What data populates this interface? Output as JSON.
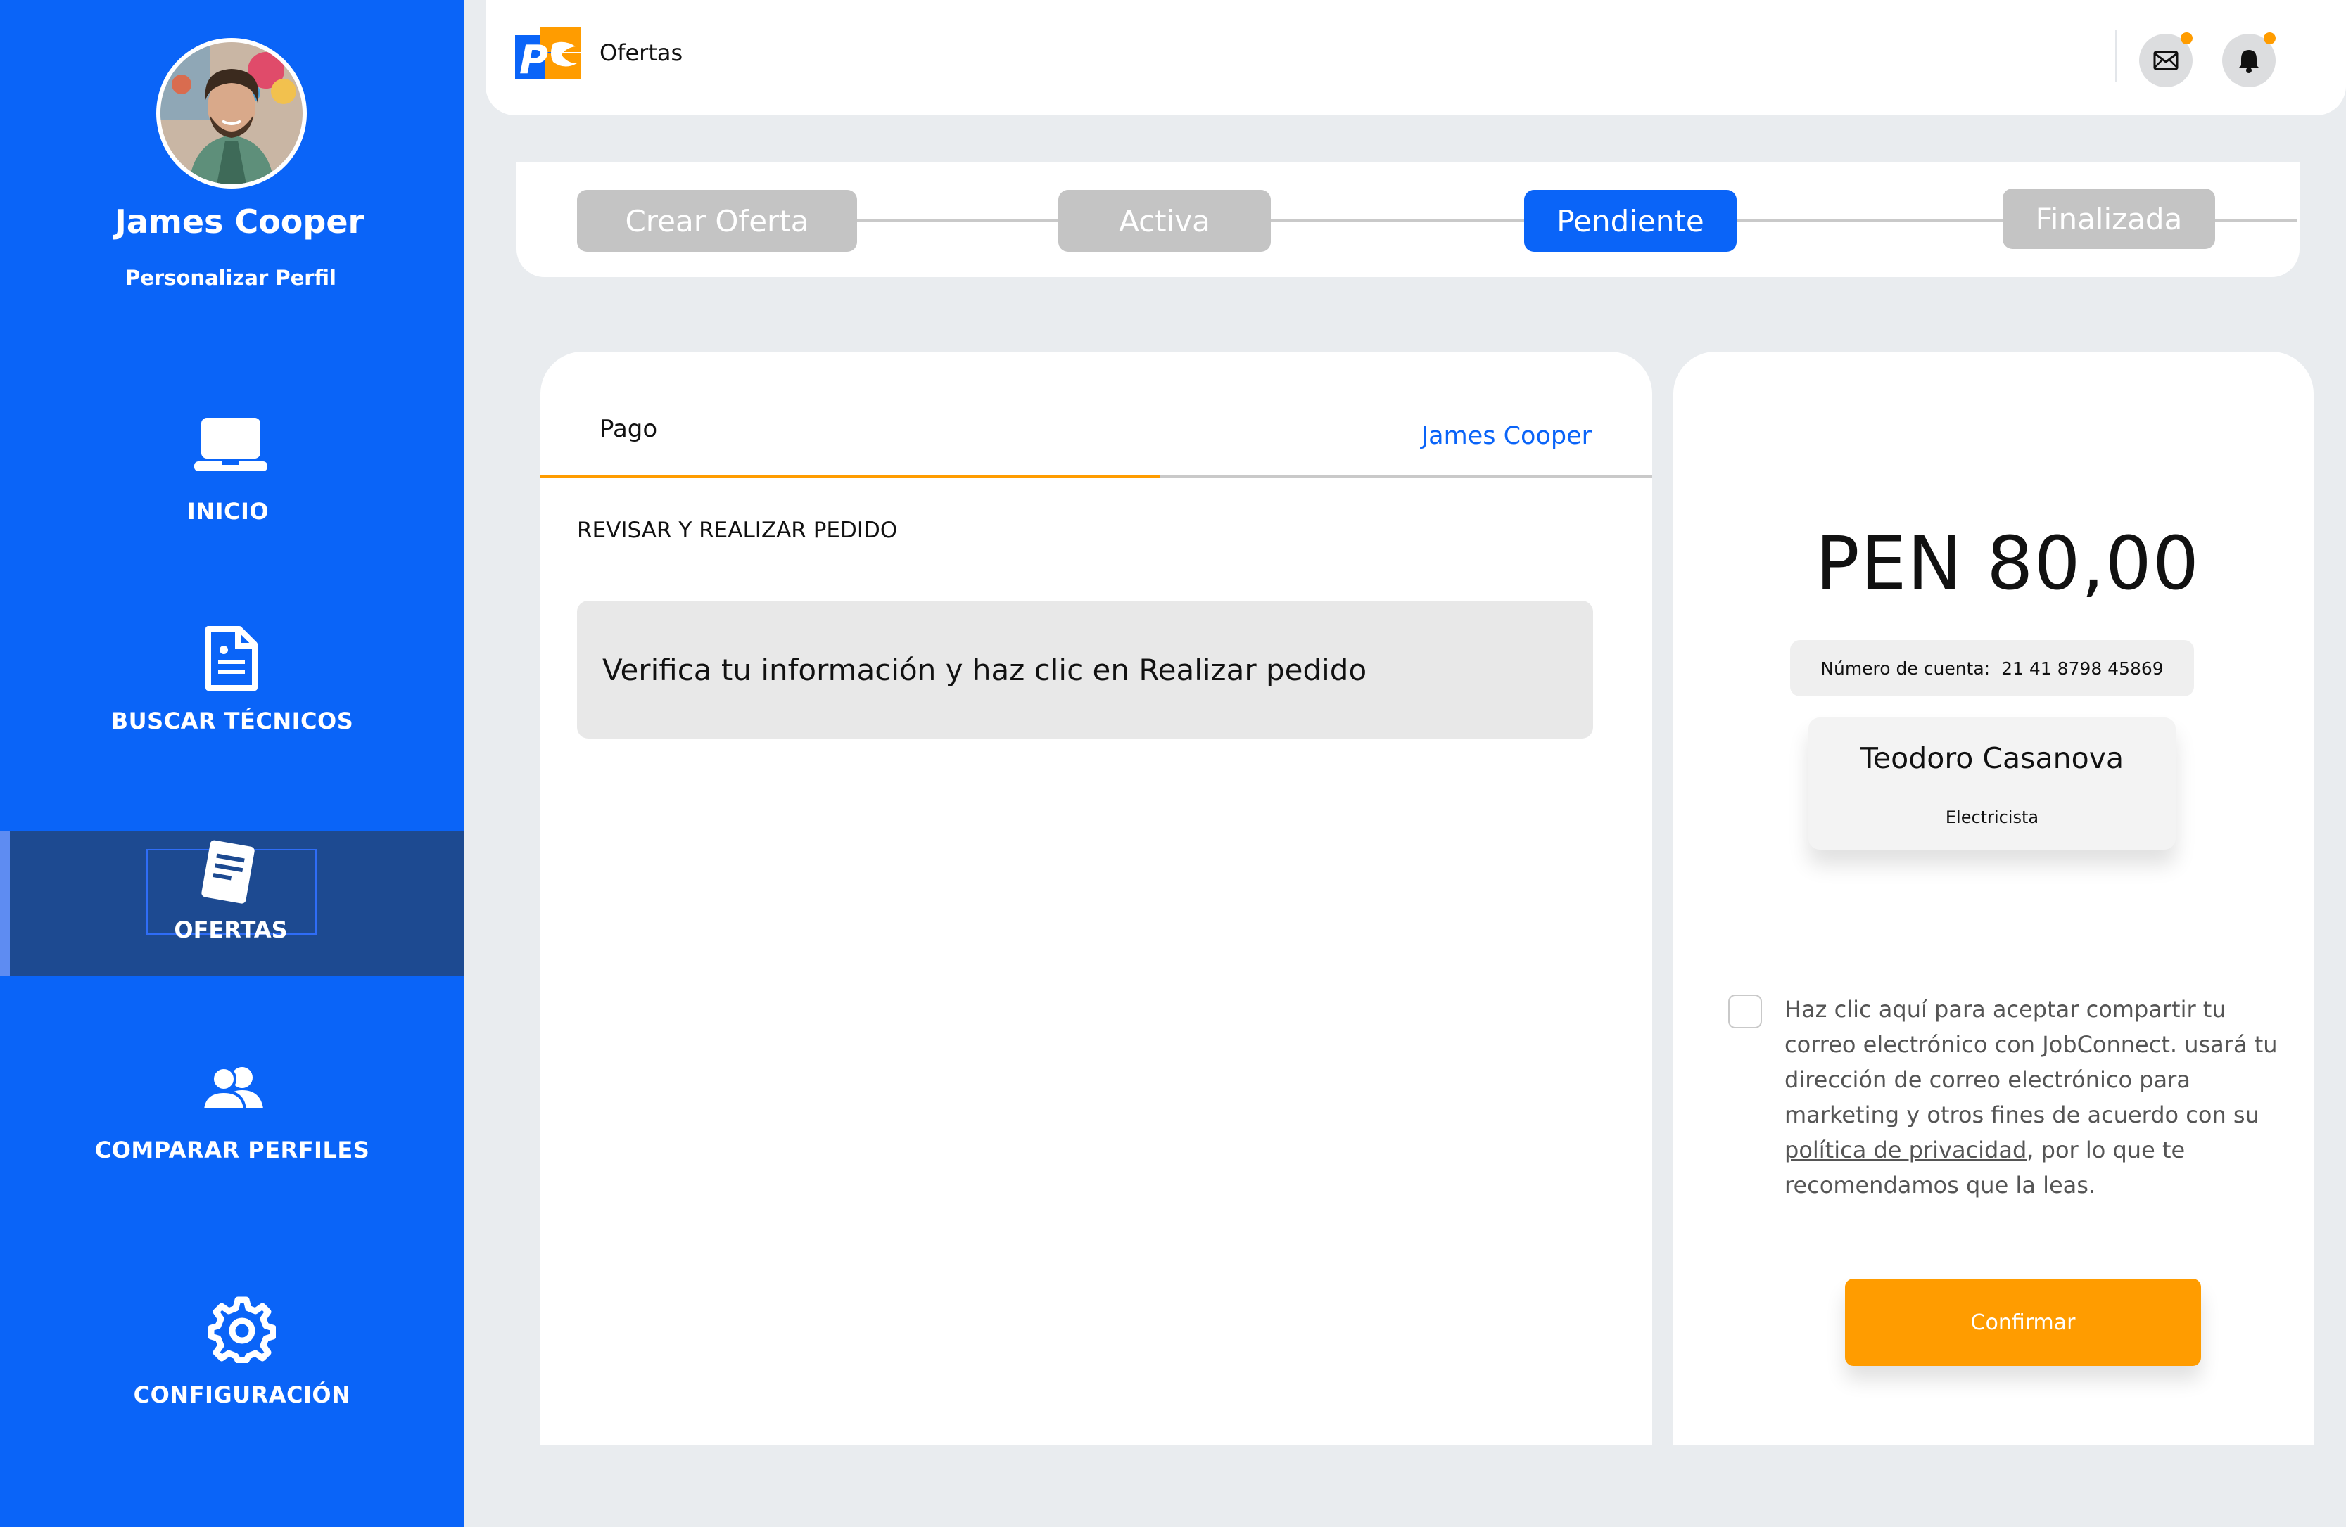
{
  "sidebar": {
    "user_name": "James Cooper",
    "profile_link": "Personalizar Perfil",
    "items": [
      {
        "label": "INICIO",
        "icon": "laptop-icon"
      },
      {
        "label": "BUSCAR TÉCNICOS",
        "icon": "document-icon"
      },
      {
        "label": "OFERTAS",
        "icon": "offer-note-icon",
        "active": true
      },
      {
        "label": "COMPARAR PERFILES",
        "icon": "users-icon"
      },
      {
        "label": "CONFIGURACIÓN",
        "icon": "gear-icon"
      }
    ]
  },
  "header": {
    "title": "Ofertas",
    "icons": [
      "mail-icon",
      "bell-icon"
    ]
  },
  "stepper": {
    "steps": [
      {
        "label": "Crear Oferta",
        "active": false
      },
      {
        "label": "Activa",
        "active": false
      },
      {
        "label": "Pendiente",
        "active": true
      },
      {
        "label": "Finalizada",
        "active": false
      }
    ]
  },
  "payment": {
    "tab_label": "Pago",
    "tab_user": "James Cooper",
    "section_title": "REVISAR Y REALIZAR PEDIDO",
    "info_message": "Verifica tu información y haz clic en Realizar pedido"
  },
  "summary": {
    "amount": "PEN 80,00",
    "account_label": "Número de cuenta:",
    "account_number": "21 41 8798 45869",
    "professional_name": "Teodoro Casanova",
    "professional_role": "Electricista",
    "consent_before": "Haz clic aquí para aceptar compartir tu correo electrónico con JobConnect. usará tu dirección de correo electrónico para marketing y otros fines de acuerdo con su ",
    "consent_link": "política de privacidad",
    "consent_after": ", por lo que te recomendamos que la leas.",
    "confirm_label": "Confirmar"
  },
  "colors": {
    "primary": "#0A64F8",
    "sidebar_active": "#1D4A91",
    "accent": "#FF9C00",
    "inactive_step": "#C4C4C4",
    "background": "#E9ECEF"
  }
}
